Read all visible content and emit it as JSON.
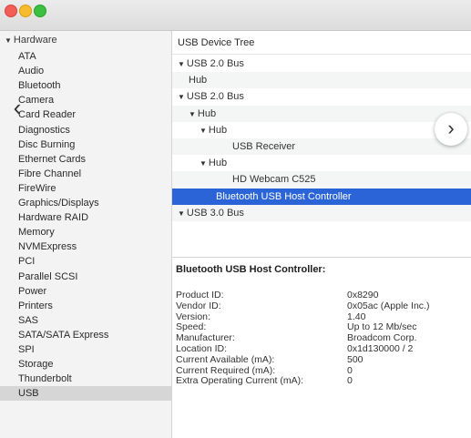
{
  "sidebar": {
    "root": {
      "label": "Hardware",
      "icon": "disclosure-triangle-down-icon"
    },
    "items": [
      "ATA",
      "Audio",
      "Bluetooth",
      "Camera",
      "Card Reader",
      "Diagnostics",
      "Disc Burning",
      "Ethernet Cards",
      "Fibre Channel",
      "FireWire",
      "Graphics/Displays",
      "Hardware RAID",
      "Memory",
      "NVMExpress",
      "PCI",
      "Parallel SCSI",
      "Power",
      "Printers",
      "SAS",
      "SATA/SATA Express",
      "SPI",
      "Storage",
      "Thunderbolt",
      "USB"
    ],
    "selected": "USB"
  },
  "device_tree": {
    "header": "USB Device Tree",
    "rows": [
      {
        "label": "USB 2.0 Bus",
        "expanded": true
      },
      {
        "label": "Hub",
        "expanded": false
      },
      {
        "label": "USB 2.0 Bus",
        "expanded": true
      },
      {
        "label": "Hub",
        "expanded": true
      },
      {
        "label": "Hub",
        "expanded": true
      },
      {
        "label": "USB Receiver",
        "expanded": false
      },
      {
        "label": "Hub",
        "expanded": true
      },
      {
        "label": "HD Webcam C525",
        "expanded": false
      },
      {
        "label": "Bluetooth USB Host Controller",
        "expanded": false,
        "selected": true
      },
      {
        "label": "USB 3.0 Bus",
        "expanded": true
      }
    ]
  },
  "details": {
    "title": "Bluetooth USB Host Controller:",
    "fields": [
      {
        "label": "Product ID:",
        "value": "0x8290"
      },
      {
        "label": "Vendor ID:",
        "value": "0x05ac  (Apple Inc.)"
      },
      {
        "label": "Version:",
        "value": "1.40"
      },
      {
        "label": "Speed:",
        "value": "Up to 12 Mb/sec"
      },
      {
        "label": "Manufacturer:",
        "value": "Broadcom Corp."
      },
      {
        "label": "Location ID:",
        "value": "0x1d130000 / 2"
      },
      {
        "label": "Current Available (mA):",
        "value": "500"
      },
      {
        "label": "Current Required (mA):",
        "value": "0"
      },
      {
        "label": "Extra Operating Current (mA):",
        "value": "0"
      }
    ]
  },
  "navigation": {
    "back_glyph": "‹",
    "forward_glyph": "›",
    "back_icon": "chevron-left-icon",
    "forward_icon": "chevron-right-icon"
  },
  "colors": {
    "selection": "#2a64d6",
    "close": "#f25f58",
    "minimize": "#f7bb2f",
    "zoom": "#3dc042"
  }
}
